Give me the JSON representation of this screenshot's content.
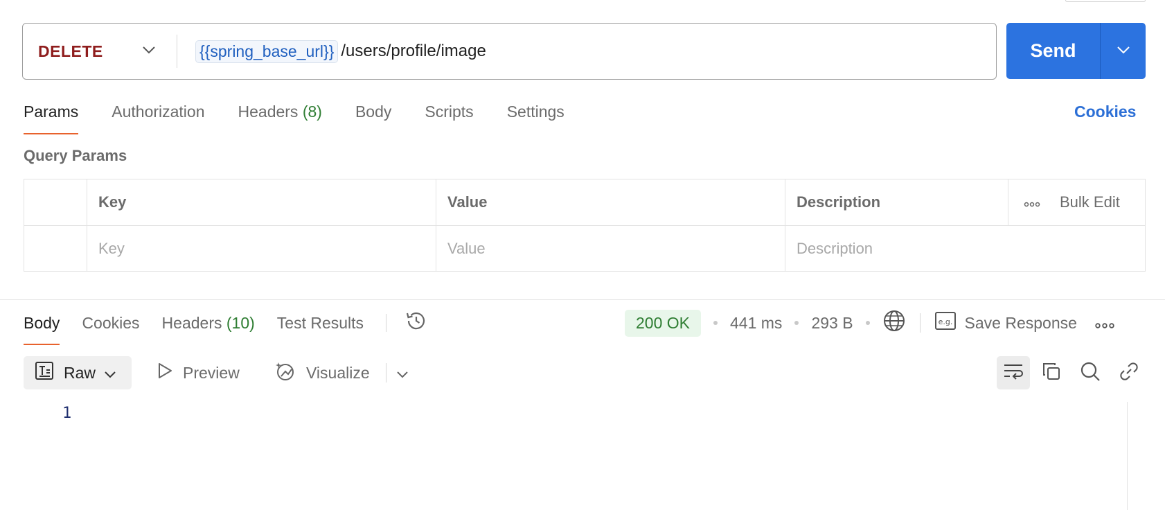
{
  "request": {
    "method": "DELETE",
    "url_variable": "{{spring_base_url}}",
    "url_path": "/users/profile/image",
    "send_label": "Send"
  },
  "request_tabs": {
    "params": "Params",
    "authorization": "Authorization",
    "headers": "Headers",
    "headers_count": "(8)",
    "body": "Body",
    "scripts": "Scripts",
    "settings": "Settings",
    "cookies": "Cookies"
  },
  "query_params": {
    "title": "Query Params",
    "columns": {
      "key": "Key",
      "value": "Value",
      "description": "Description"
    },
    "bulk_edit": "Bulk Edit",
    "placeholders": {
      "key": "Key",
      "value": "Value",
      "description": "Description"
    }
  },
  "response": {
    "tabs": {
      "body": "Body",
      "cookies": "Cookies",
      "headers": "Headers",
      "headers_count": "(10)",
      "test_results": "Test Results"
    },
    "status": "200 OK",
    "time": "441 ms",
    "size": "293 B",
    "save_response": "Save Response",
    "format": "Raw",
    "preview": "Preview",
    "visualize": "Visualize",
    "line_number": "1"
  },
  "colors": {
    "method_delete": "#8f1d1d",
    "send_button": "#2c73e0",
    "active_tab_underline": "#e8622d",
    "count_green": "#2e7d32",
    "status_ok_bg": "#e8f6ea",
    "link_blue": "#2c6fd6"
  }
}
